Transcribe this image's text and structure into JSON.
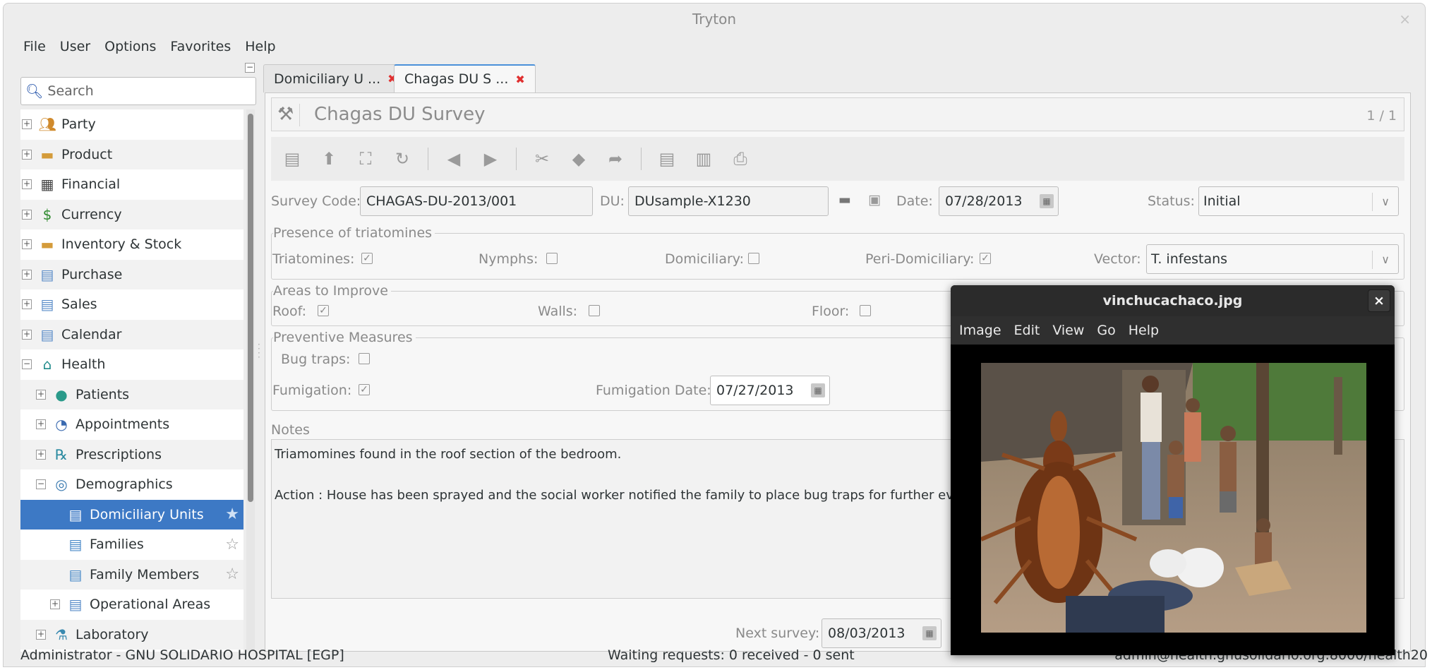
{
  "window": {
    "title": "Tryton",
    "close": "×"
  },
  "menubar": [
    "File",
    "User",
    "Options",
    "Favorites",
    "Help"
  ],
  "sidebar": {
    "search_placeholder": "Search",
    "items": [
      {
        "label": "Party",
        "icon": "party-icon",
        "level": 0,
        "expander": "+",
        "alt": false
      },
      {
        "label": "Product",
        "icon": "product-icon",
        "level": 0,
        "expander": "+",
        "alt": true
      },
      {
        "label": "Financial",
        "icon": "calculator-icon",
        "level": 0,
        "expander": "+",
        "alt": false
      },
      {
        "label": "Currency",
        "icon": "currency-icon",
        "level": 0,
        "expander": "+",
        "alt": true
      },
      {
        "label": "Inventory & Stock",
        "icon": "inventory-icon",
        "level": 0,
        "expander": "+",
        "alt": false
      },
      {
        "label": "Purchase",
        "icon": "folder-icon",
        "level": 0,
        "expander": "+",
        "alt": true
      },
      {
        "label": "Sales",
        "icon": "folder-icon",
        "level": 0,
        "expander": "+",
        "alt": false
      },
      {
        "label": "Calendar",
        "icon": "folder-icon",
        "level": 0,
        "expander": "+",
        "alt": true
      },
      {
        "label": "Health",
        "icon": "health-icon",
        "level": 0,
        "expander": "−",
        "alt": false
      },
      {
        "label": "Patients",
        "icon": "patient-icon",
        "level": 1,
        "expander": "+",
        "alt": true
      },
      {
        "label": "Appointments",
        "icon": "clock-icon",
        "level": 1,
        "expander": "+",
        "alt": false
      },
      {
        "label": "Prescriptions",
        "icon": "prescription-icon",
        "level": 1,
        "expander": "+",
        "alt": true
      },
      {
        "label": "Demographics",
        "icon": "globe-icon",
        "level": 1,
        "expander": "−",
        "alt": false
      },
      {
        "label": "Domiciliary Units",
        "icon": "document-icon",
        "level": 2,
        "expander": "",
        "alt": false,
        "selected": true,
        "star": true
      },
      {
        "label": "Families",
        "icon": "document-icon",
        "level": 2,
        "expander": "",
        "alt": false,
        "star": true
      },
      {
        "label": "Family Members",
        "icon": "document-icon",
        "level": 2,
        "expander": "",
        "alt": true,
        "star": true
      },
      {
        "label": "Operational Areas",
        "icon": "folder-icon",
        "level": 2,
        "expander": "+",
        "alt": false
      },
      {
        "label": "Laboratory",
        "icon": "lab-icon",
        "level": 1,
        "expander": "+",
        "alt": true
      }
    ]
  },
  "tabs": [
    {
      "label": "Domiciliary U ...",
      "active": false
    },
    {
      "label": "Chagas DU S ...",
      "active": true
    }
  ],
  "form": {
    "title": "Chagas DU Survey",
    "record_count": "1 / 1",
    "survey_code_label": "Survey Code:",
    "survey_code": "CHAGAS-DU-2013/001",
    "du_label": "DU:",
    "du": "DUsample-X1230",
    "date_label": "Date:",
    "date": "07/28/2013",
    "status_label": "Status:",
    "status": "Initial",
    "presence_group": "Presence of triatomines",
    "triatomines_label": "Triatomines:",
    "nymphs_label": "Nymphs:",
    "domiciliary_label": "Domiciliary:",
    "peri_label": "Peri-Domiciliary:",
    "vector_label": "Vector:",
    "vector": "T. infestans",
    "areas_group": "Areas to Improve",
    "roof_label": "Roof:",
    "walls_label": "Walls:",
    "floor_label": "Floor:",
    "preventive_group": "Preventive Measures",
    "bugtraps_label": "Bug traps:",
    "fumigation_label": "Fumigation:",
    "fumigation_date_label": "Fumigation Date:",
    "fumigation_date": "07/27/2013",
    "notes_label": "Notes",
    "notes_text": "Triamomines found in the roof section of the bedroom.\n\nAction : House has been sprayed and the social worker notified the family to place bug traps for further evalua",
    "next_survey_label": "Next survey:",
    "next_survey": "08/03/2013",
    "checks": {
      "triatomines": true,
      "nymphs": false,
      "domiciliary": false,
      "peri": true,
      "roof": true,
      "walls": false,
      "floor": false,
      "bugtraps": false,
      "fumigation": true
    }
  },
  "statusbar": {
    "left": "Administrator - GNU SOLIDARIO HOSPITAL [EGP]",
    "center": "Waiting requests: 0 received - 0 sent",
    "right": "admin@health.gnusolidario.org:8000/health20"
  },
  "viewer": {
    "title": "vinchucachaco.jpg",
    "close": "×",
    "menu": [
      "Image",
      "Edit",
      "View",
      "Go",
      "Help"
    ]
  },
  "colors": {
    "selection": "#3d79c5",
    "tab_accent": "#4a90d9",
    "viewer_bg": "#000000"
  }
}
